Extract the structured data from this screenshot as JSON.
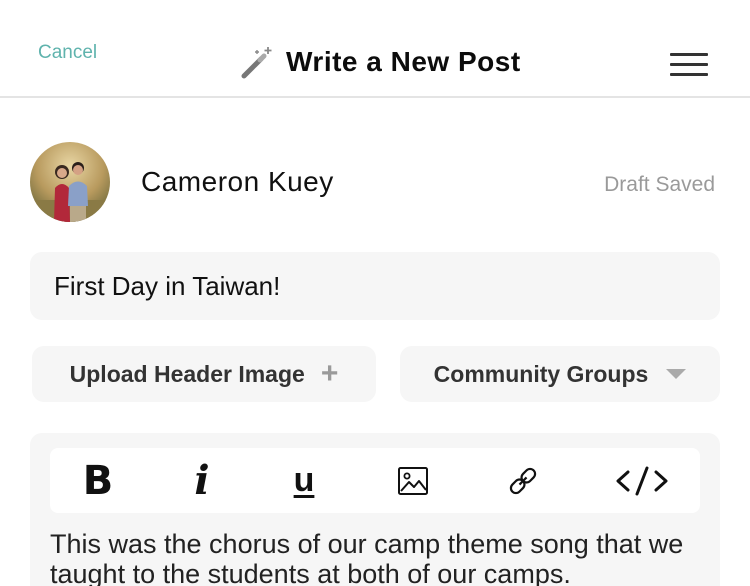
{
  "header": {
    "cancel_label": "Cancel",
    "title": "Write a New Post",
    "title_icon": "magic-wand-icon",
    "menu_icon": "hamburger-menu-icon"
  },
  "author": {
    "name": "Cameron Kuey",
    "avatar_icon": "user-avatar-photo",
    "draft_status": "Draft Saved"
  },
  "post": {
    "title_value": "First Day in Taiwan!",
    "upload_label": "Upload Header Image",
    "upload_icon": "plus-icon",
    "groups_label": "Community Groups",
    "groups_icon": "caret-down-icon"
  },
  "editor": {
    "toolbar": {
      "bold": "B",
      "italic": "i",
      "underline": "u",
      "image_icon": "image-icon",
      "link_icon": "link-icon",
      "code_icon": "code-icon"
    },
    "body_text": "This was the chorus of our camp theme song that we taught to the students at both of our camps."
  },
  "colors": {
    "accent": "#5fb3ad",
    "muted_text": "#9a9a9a",
    "field_bg": "#f6f6f6"
  }
}
